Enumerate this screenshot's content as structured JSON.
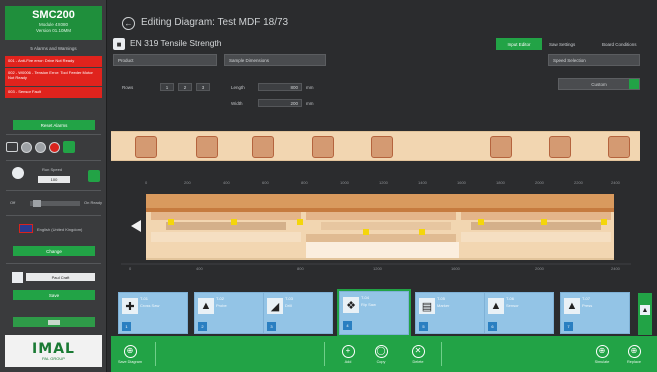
{
  "sidebar": {
    "brand_title": "SMC200",
    "brand_line1": "Module 4X080",
    "brand_line2": "Version 01.10MM",
    "alarm_title": "5 Alarms and Warnings",
    "alarms": [
      "001 - Anti-Fire error: Drive Not Ready",
      "002 - W0006 - Tension Error: Tool Feeder Motor Not Ready",
      "003 - Sensor Fault"
    ],
    "reset_label": "Reset Alarms",
    "speed_label": "Run Speed",
    "speed_value": "100",
    "off_label": "Off",
    "on_label": "On Ready",
    "language_label": "English (United Kingdom)",
    "language_btn": "Change",
    "user_field": "Paul Craft",
    "user_btn": "Save",
    "brand_logo": "IMAL",
    "brand_logo_sub": "PAL GROUP"
  },
  "header": {
    "title": "Editing Diagram: Test MDF 18/73",
    "subtitle": "EN 319 Tensile Strength",
    "tabs": [
      "Input Editor",
      "Saw Settings",
      "Board Conditions"
    ],
    "active_tab": "Input Editor"
  },
  "form": {
    "field1": "Product",
    "field2": "Sample Dimensions",
    "field3": "Speed Selection",
    "rows_label": "Rows",
    "rows_values": [
      "1",
      "2",
      "3"
    ],
    "length_label": "Length",
    "length_value": "800",
    "length_unit": "mm",
    "width_label": "Width",
    "width_value": "200",
    "width_unit": "mm",
    "toggle_label": "Custom"
  },
  "diagram": {
    "ticks": [
      "0",
      "200",
      "400",
      "600",
      "800",
      "1000",
      "1200",
      "1400",
      "1600",
      "1800",
      "2000",
      "2200",
      "2400"
    ]
  },
  "tools": [
    {
      "num": "T-01",
      "name": "Cross Saw",
      "icon": "crosscut-icon",
      "badge": "1"
    },
    {
      "num": "T-02",
      "name": "Probe",
      "icon": "stamp-icon",
      "badge": "2"
    },
    {
      "num": "T-03",
      "name": "Drill",
      "icon": "drill-icon",
      "badge": "3"
    },
    {
      "num": "T-04",
      "name": "Rip Saw",
      "icon": "ripsaw-icon",
      "badge": "4"
    },
    {
      "num": "T-05",
      "name": "Marker",
      "icon": "marker-icon",
      "badge": "5"
    },
    {
      "num": "T-06",
      "name": "Sensor",
      "icon": "sensor-icon",
      "badge": "6"
    },
    {
      "num": "T-07",
      "name": "Press",
      "icon": "press-icon",
      "badge": "7"
    }
  ],
  "bottombar": {
    "left": "Save Diagram",
    "center": [
      "Add",
      "Copy",
      "Delete"
    ],
    "right": [
      "Simulate",
      "Replace"
    ]
  },
  "colors": {
    "accent": "#22a346",
    "alarm": "#e0231d",
    "card": "#93c4e6"
  }
}
